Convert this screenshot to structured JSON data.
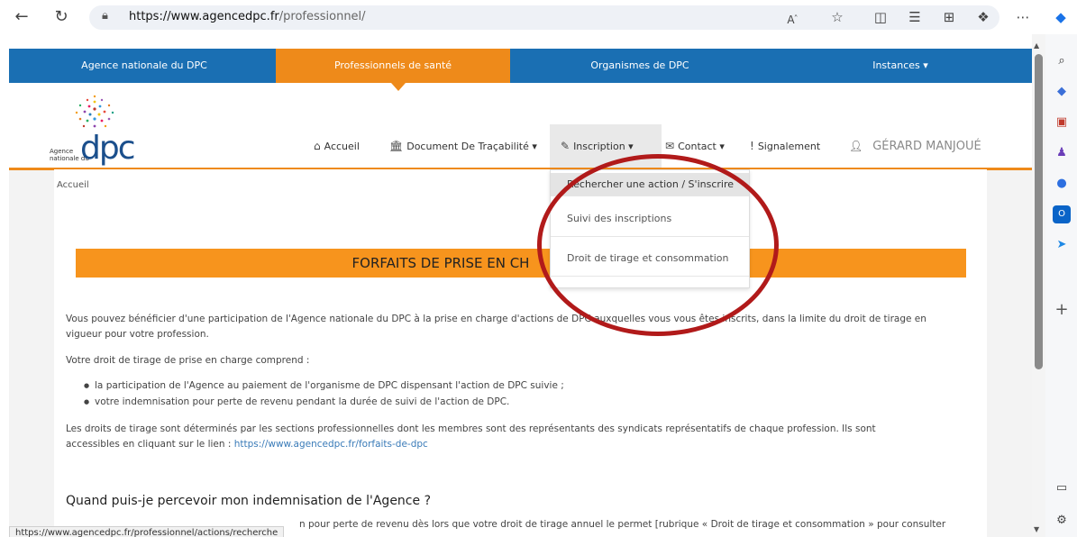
{
  "browser": {
    "url_domain": "https://www.agencedpc.fr",
    "url_path": "/professionnel/",
    "status_url": "https://www.agencedpc.fr/professionnel/actions/recherche"
  },
  "topnav": {
    "items": [
      "Agence nationale du DPC",
      "Professionnels de santé",
      "Organismes de DPC",
      "Instances ▾"
    ],
    "active": "Professionnels de santé",
    "bg_color": "#1a6fb3",
    "active_color": "#ee8a1a"
  },
  "logo": {
    "small_text_1": "Agence",
    "small_text_2": "nationale du",
    "brand": "dpc"
  },
  "mainnav": {
    "accueil": "Accueil",
    "document": "Document De Traçabilité ▾",
    "inscription": "Inscription ▾",
    "contact": "Contact ▾",
    "signalement": "Signalement",
    "user": "GÉRARD MANJOUÉ"
  },
  "dropdown": {
    "items": [
      "Rechercher une action / S'inscrire",
      "Suivi des inscriptions",
      "Droit de tirage et consommation"
    ]
  },
  "breadcrumb": "Accueil",
  "banner_title": "FORFAITS DE PRISE EN CH",
  "content": {
    "para1_line1": "Vous pouvez bénéficier d'une participation de l'Agence nationale du DPC à la prise en charge d'actions de DPC auxquelles vous vous êtes inscrits, dans la limite du droit de tirage en",
    "para1_line2": "vigueur pour votre profession.",
    "para2": "Votre droit de tirage de prise en charge comprend :",
    "bullet1": "la participation de l'Agence au paiement de l'organisme de DPC dispensant l'action de DPC suivie ;",
    "bullet2": "votre indemnisation pour perte de revenu pendant la durée de suivi de l'action de DPC.",
    "para3_line1": "Les droits de tirage sont déterminés par les sections professionnelles dont les membres sont des représentants des syndicats représentatifs de chaque profession. Ils sont",
    "para3_line2": "accessibles en cliquant sur le lien : ",
    "para3_link": "https://www.agencedpc.fr/forfaits-de-dpc",
    "heading": "Quand puis-je percevoir mon indemnisation de l'Agence ?",
    "bottom": "n pour perte de revenu dès lors que votre droit de tirage annuel le permet [rubrique « Droit de tirage et consommation » pour consulter"
  }
}
